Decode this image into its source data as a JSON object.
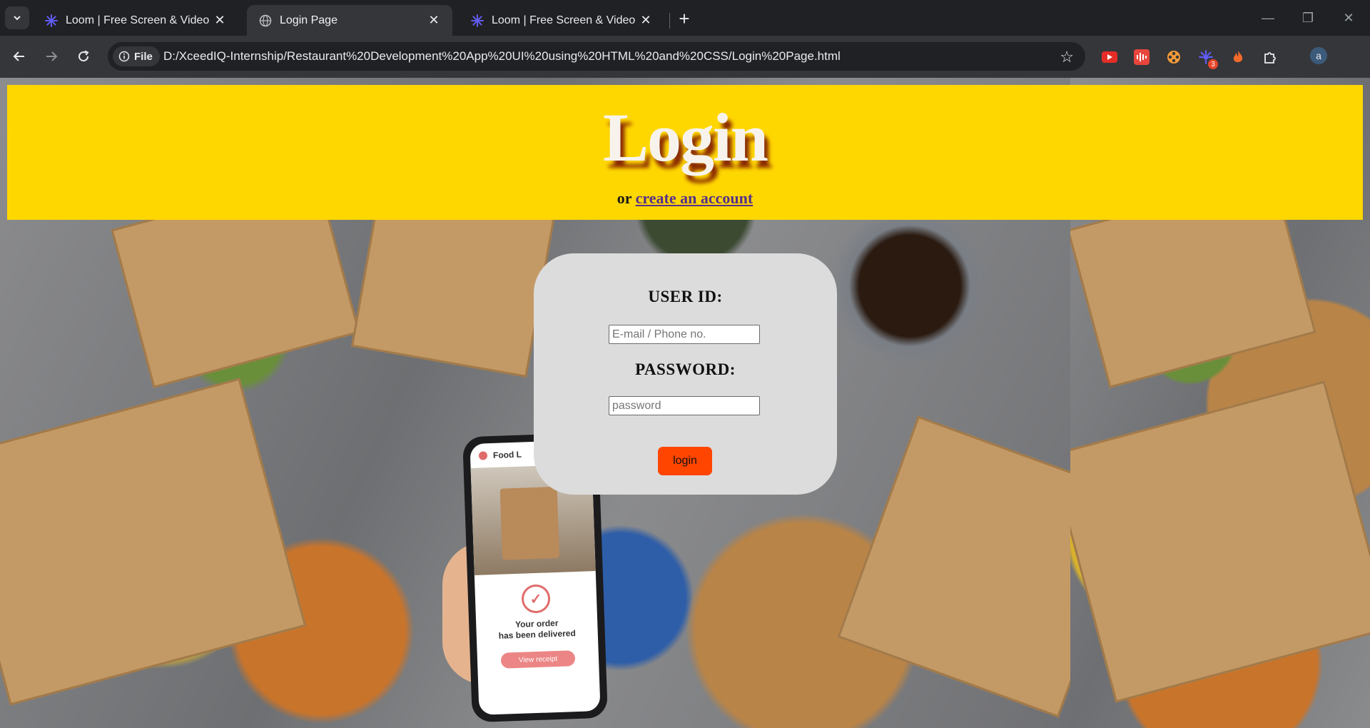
{
  "browser": {
    "tabs": [
      {
        "title": "Loom | Free Screen & Video Re",
        "favicon": "loom-icon",
        "active": false
      },
      {
        "title": "Login Page",
        "favicon": "globe-icon",
        "active": true
      },
      {
        "title": "Loom | Free Screen & Video Re",
        "favicon": "loom-icon",
        "active": false
      }
    ],
    "site_chip": "File",
    "url": "D:/XceedIQ-Internship/Restaurant%20Development%20App%20UI%20using%20HTML%20and%20CSS/Login%20Page.html",
    "extension_badge": "3",
    "profile_initial": "a"
  },
  "page": {
    "title": "Login",
    "subtitle_prefix": "or",
    "subtitle_link": "create an account",
    "form": {
      "userid_label": "USER ID:",
      "userid_placeholder": "E-mail / Phone no.",
      "password_label": "PASSWORD:",
      "password_placeholder": "password",
      "login_button": "login"
    },
    "background_phone": {
      "app_title": "Food L",
      "status_line1": "Your order",
      "status_line2": "has been delivered",
      "receipt_button": "View receipt"
    }
  },
  "colors": {
    "banner": "#ffd700",
    "login_button": "#ff4500",
    "card": "#dcdcdc",
    "link": "#55308a"
  }
}
